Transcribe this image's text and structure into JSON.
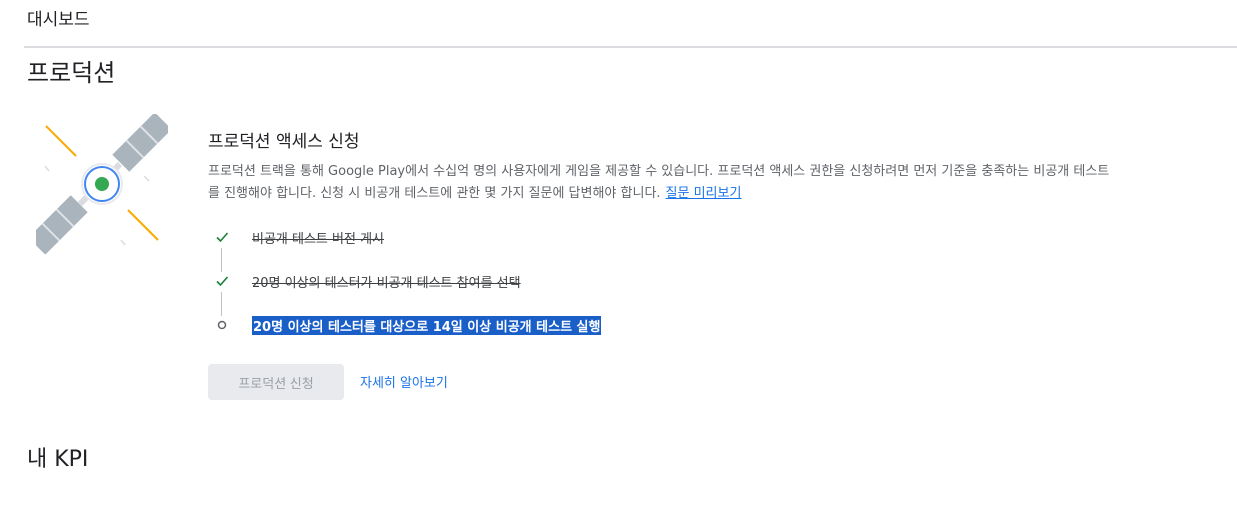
{
  "breadcrumb": "대시보드",
  "section": {
    "title": "프로덕션"
  },
  "card": {
    "title": "프로덕션 액세스 신청",
    "description": "프로덕션 트랙을 통해 Google Play에서 수십억 명의 사용자에게 게임을 제공할 수 있습니다. 프로덕션 액세스 권한을 신청하려면 먼저 기준을 충족하는 비공개 테스트를 진행해야 합니다. 신청 시 비공개 테스트에 관한 몇 가지 질문에 답변해야 합니다.",
    "preview_link": "질문 미리보기",
    "steps": [
      {
        "label": "비공개 테스트 버전 게시",
        "status": "done",
        "icon": "check-icon"
      },
      {
        "label": "20명 이상의 테스터가 비공개 테스트 참여를 선택",
        "status": "done",
        "icon": "check-icon"
      },
      {
        "label": "20명 이상의 테스터를 대상으로 14일 이상 비공개 테스트 실행",
        "status": "current",
        "icon": "circle-outline-icon"
      }
    ],
    "apply_button": "프로덕션 신청",
    "learn_more": "자세히 알아보기"
  },
  "kpi": {
    "title": "내 KPI"
  },
  "colors": {
    "accent": "#1a73e8",
    "check": "#188038",
    "selection": "#1a5fc8",
    "satellite_panel": "#aab4bd",
    "satellite_rays": "#f9ab00",
    "satellite_center": "#34a853"
  }
}
